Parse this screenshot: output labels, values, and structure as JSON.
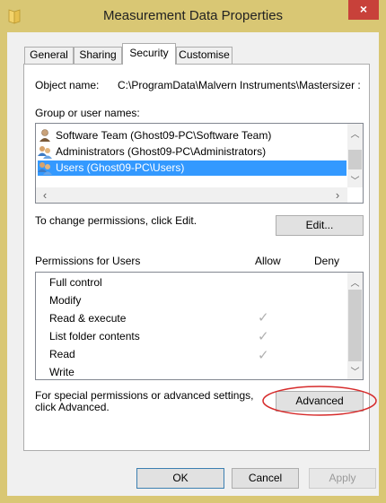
{
  "window": {
    "title": "Measurement Data Properties",
    "close_glyph": "×",
    "frame_color": "#d9c774"
  },
  "tabs": [
    {
      "label": "General"
    },
    {
      "label": "Sharing"
    },
    {
      "label": "Security",
      "active": true
    },
    {
      "label": "Customise"
    }
  ],
  "security": {
    "object_name_label": "Object name:",
    "object_name_value": "C:\\ProgramData\\Malvern Instruments\\Mastersizer :",
    "group_label": "Group or user names:",
    "groups": [
      {
        "icon": "user-icon",
        "name": "Software Team (Ghost09-PC\\Software Team)"
      },
      {
        "icon": "group-icon",
        "name": "Administrators (Ghost09-PC\\Administrators)"
      },
      {
        "icon": "group-icon",
        "name": "Users (Ghost09-PC\\Users)",
        "selected": true
      }
    ],
    "change_text": "To change permissions, click Edit.",
    "edit_label": "Edit...",
    "permissions_for": "Permissions for Users",
    "allow_header": "Allow",
    "deny_header": "Deny",
    "permissions": [
      {
        "name": "Full control",
        "allow": false,
        "deny": false
      },
      {
        "name": "Modify",
        "allow": false,
        "deny": false
      },
      {
        "name": "Read & execute",
        "allow": true,
        "deny": false
      },
      {
        "name": "List folder contents",
        "allow": true,
        "deny": false
      },
      {
        "name": "Read",
        "allow": true,
        "deny": false
      },
      {
        "name": "Write",
        "allow": false,
        "deny": false
      }
    ],
    "special_text_line1": "For special permissions or advanced settings,",
    "special_text_line2": "click Advanced.",
    "advanced_label": "Advanced",
    "check_glyph": "✓",
    "highlight_color": "#d62b2b"
  },
  "footer": {
    "ok_label": "OK",
    "cancel_label": "Cancel",
    "apply_label": "Apply"
  }
}
